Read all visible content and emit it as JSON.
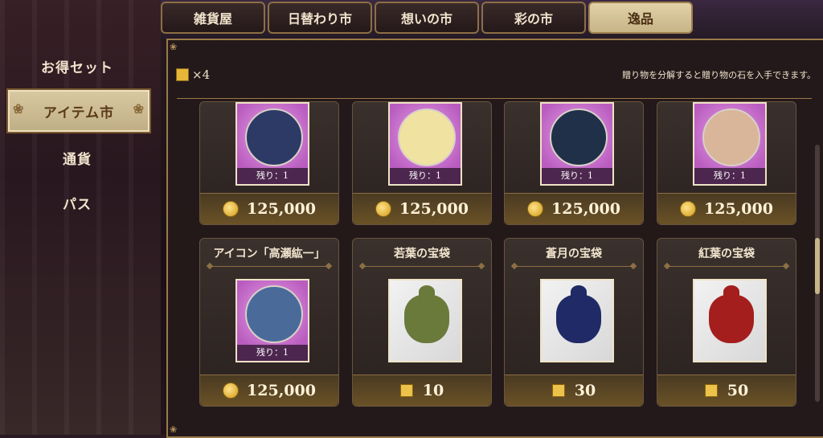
{
  "tabs": [
    {
      "label": "雑貨屋"
    },
    {
      "label": "日替わり市"
    },
    {
      "label": "想いの市"
    },
    {
      "label": "彩の市"
    },
    {
      "label": "逸品",
      "active": true
    }
  ],
  "side_menu": [
    {
      "label": "お得セット"
    },
    {
      "label": "アイテム市",
      "active": true
    },
    {
      "label": "通貨"
    },
    {
      "label": "パス"
    }
  ],
  "header": {
    "count": "×4",
    "note": "贈り物を分解すると贈り物の石を入手できます。"
  },
  "items": [
    {
      "title": "",
      "type": "avatar",
      "remain": "残り：1",
      "price": "125,000",
      "currency": "coin",
      "color": "#2d3a66"
    },
    {
      "title": "",
      "type": "avatar",
      "remain": "残り：1",
      "price": "125,000",
      "currency": "coin",
      "color": "#f0e2a0"
    },
    {
      "title": "",
      "type": "avatar",
      "remain": "残り：1",
      "price": "125,000",
      "currency": "coin",
      "color": "#1f3048"
    },
    {
      "title": "",
      "type": "avatar",
      "remain": "残り：1",
      "price": "125,000",
      "currency": "coin",
      "color": "#d9b69a"
    },
    {
      "title": "アイコン「高瀬紘一」",
      "type": "avatar",
      "remain": "残り：1",
      "price": "125,000",
      "currency": "coin",
      "color": "#4a6a9a"
    },
    {
      "title": "若葉の宝袋",
      "type": "bag",
      "remain": "",
      "price": "10",
      "currency": "gem",
      "color": "#6a7a3a"
    },
    {
      "title": "蒼月の宝袋",
      "type": "bag",
      "remain": "",
      "price": "30",
      "currency": "gem",
      "color": "#1f2a66"
    },
    {
      "title": "紅葉の宝袋",
      "type": "bag",
      "remain": "",
      "price": "50",
      "currency": "gem",
      "color": "#a41e1e"
    }
  ]
}
